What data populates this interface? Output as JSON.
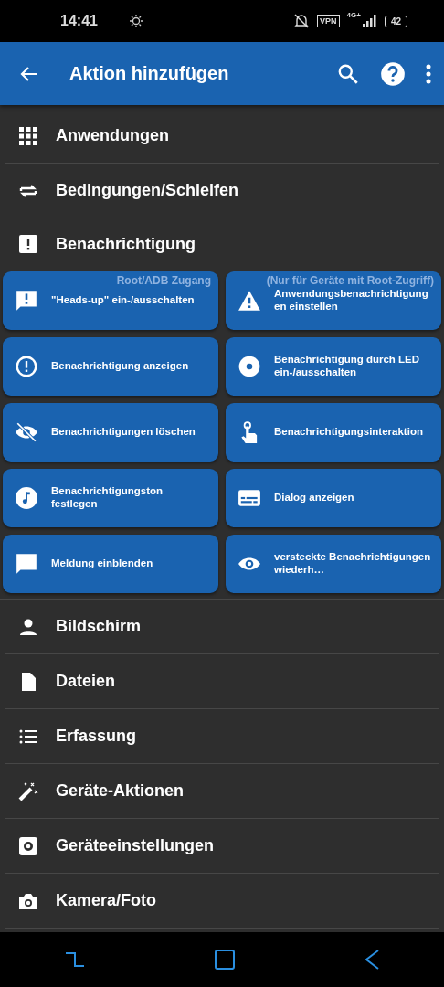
{
  "status_bar": {
    "time": "14:41",
    "vpn": "VPN",
    "network": "4G+",
    "battery": "42"
  },
  "app_bar": {
    "title": "Aktion hinzufügen"
  },
  "categories": [
    {
      "label": "Anwendungen",
      "expanded": false
    },
    {
      "label": "Bedingungen/Schleifen",
      "expanded": false
    },
    {
      "label": "Benachrichtigung",
      "expanded": true,
      "actions": [
        {
          "label": "\"Heads-up\" ein-/ausschalten",
          "note": "Root/ADB Zugang"
        },
        {
          "label": "Anwendungsbenachrichtigungen einstellen",
          "note": "(Nur für Geräte mit Root-Zugriff)"
        },
        {
          "label": "Benachrichtigung anzeigen"
        },
        {
          "label": "Benachrichtigung durch LED ein-/ausschalten"
        },
        {
          "label": "Benachrichtigungen löschen"
        },
        {
          "label": "Benachrichtigungsinteraktion"
        },
        {
          "label": "Benachrichtigungston festlegen"
        },
        {
          "label": "Dialog anzeigen"
        },
        {
          "label": "Meldung einblenden"
        },
        {
          "label": "versteckte Benachrichtigungen wiederh…"
        }
      ]
    },
    {
      "label": "Bildschirm",
      "expanded": false
    },
    {
      "label": "Dateien",
      "expanded": false
    },
    {
      "label": "Erfassung",
      "expanded": false
    },
    {
      "label": "Geräte-Aktionen",
      "expanded": false
    },
    {
      "label": "Geräteeinstellungen",
      "expanded": false
    },
    {
      "label": "Kamera/Foto",
      "expanded": false
    }
  ]
}
